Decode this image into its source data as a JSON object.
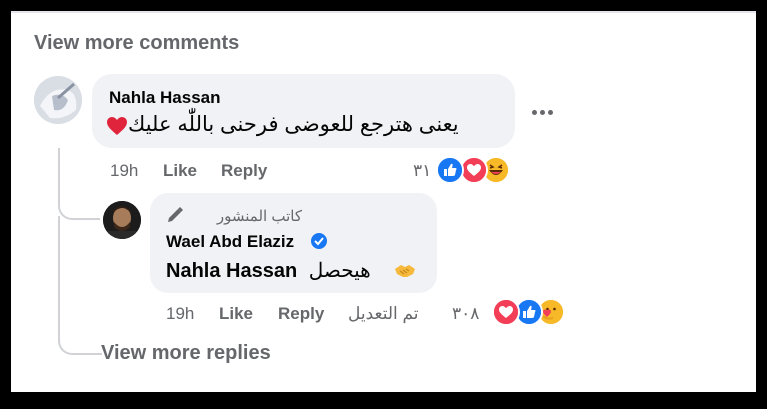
{
  "view_more_comments": "View more comments",
  "comment": {
    "author": "Nahla Hassan",
    "text": "يعنى هترجع للعوضى فرحنى باللّٰه عليك",
    "time": "19h",
    "like_label": "Like",
    "reply_label": "Reply",
    "reaction_count": "٣١",
    "reactions": [
      "like-icon",
      "love-icon",
      "haha-icon"
    ]
  },
  "reply": {
    "author_badge": "كاتب المنشور",
    "author": "Wael Abd Elaziz",
    "verified_icon": "verified-badge-icon",
    "text_rtl": "هيحصل",
    "mention": "Nahla Hassan",
    "time": "19h",
    "like_label": "Like",
    "reply_label": "Reply",
    "edited_label": "تم التعديل",
    "reaction_count": "٣٠٨",
    "reactions": [
      "love-icon",
      "like-icon",
      "care-icon"
    ]
  },
  "view_more_replies": "View more replies",
  "colors": {
    "like_blue": "#1877f2",
    "love_red": "#f33e58",
    "text": "#050505",
    "muted": "#65676b"
  }
}
